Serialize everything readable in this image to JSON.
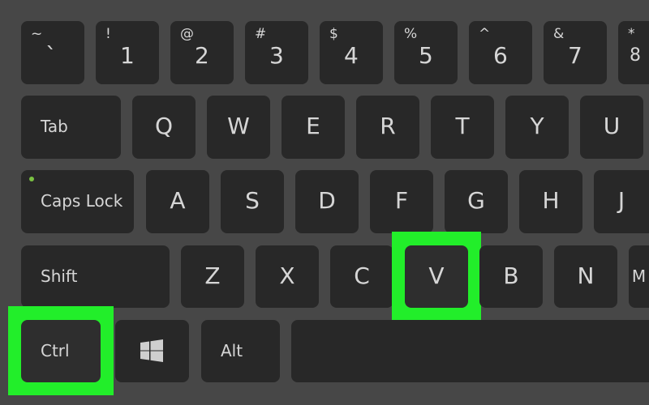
{
  "highlight_color": "#22ee2a",
  "rows": [
    [
      {
        "sec": "~",
        "pri": "`"
      },
      {
        "sec": "!",
        "pri": "1"
      },
      {
        "sec": "@",
        "pri": "2"
      },
      {
        "sec": "#",
        "pri": "3"
      },
      {
        "sec": "$",
        "pri": "4"
      },
      {
        "sec": "%",
        "pri": "5"
      },
      {
        "sec": "^",
        "pri": "6"
      },
      {
        "sec": "&",
        "pri": "7"
      },
      {
        "sec": "*",
        "pri": "8"
      }
    ],
    [
      {
        "pri": "Tab"
      },
      {
        "pri": "Q"
      },
      {
        "pri": "W"
      },
      {
        "pri": "E"
      },
      {
        "pri": "R"
      },
      {
        "pri": "T"
      },
      {
        "pri": "Y"
      },
      {
        "pri": "U"
      }
    ],
    [
      {
        "pri": "Caps Lock"
      },
      {
        "pri": "A"
      },
      {
        "pri": "S"
      },
      {
        "pri": "D"
      },
      {
        "pri": "F"
      },
      {
        "pri": "G"
      },
      {
        "pri": "H"
      },
      {
        "pri": "J"
      }
    ],
    [
      {
        "pri": "Shift"
      },
      {
        "pri": "Z"
      },
      {
        "pri": "X"
      },
      {
        "pri": "C"
      },
      {
        "pri": "V",
        "highlighted": true
      },
      {
        "pri": "B"
      },
      {
        "pri": "N"
      },
      {
        "pri": "M"
      }
    ],
    [
      {
        "pri": "Ctrl",
        "highlighted": true
      },
      {
        "icon": "windows-icon"
      },
      {
        "pri": "Alt"
      },
      {
        "pri": ""
      }
    ]
  ]
}
